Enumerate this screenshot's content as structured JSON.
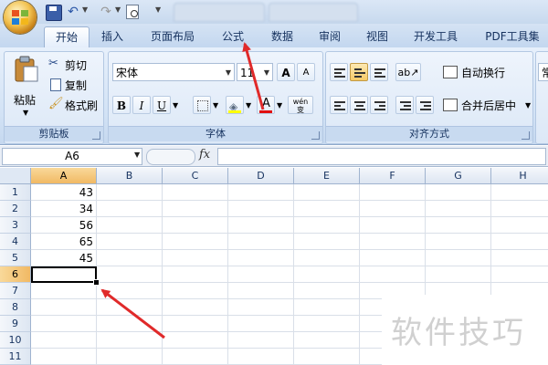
{
  "quick_access": {
    "icons": [
      "save-icon",
      "undo-icon",
      "redo-icon",
      "print-preview-icon"
    ]
  },
  "tabs": [
    {
      "label": "开始",
      "active": true
    },
    {
      "label": "插入"
    },
    {
      "label": "页面布局"
    },
    {
      "label": "公式"
    },
    {
      "label": "数据"
    },
    {
      "label": "审阅"
    },
    {
      "label": "视图"
    },
    {
      "label": "开发工具"
    },
    {
      "label": "PDF工具集"
    }
  ],
  "clipboard": {
    "paste": "粘贴",
    "cut": "剪切",
    "copy": "复制",
    "format_painter": "格式刷",
    "group_label": "剪贴板"
  },
  "font": {
    "name": "宋体",
    "size": "11",
    "bold": "B",
    "italic": "I",
    "underline": "U",
    "phonetic": "wén 变",
    "font_color": "A",
    "group_label": "字体",
    "grow": "A",
    "shrink": "A"
  },
  "alignment": {
    "wrap_text": "自动换行",
    "merge_center": "合并后居中",
    "group_label": "对齐方式"
  },
  "number_format_clip": "常",
  "formula_bar": {
    "name_box": "A6",
    "fx": "fx",
    "value": ""
  },
  "columns": [
    "A",
    "B",
    "C",
    "D",
    "E",
    "F",
    "G",
    "H"
  ],
  "rows": [
    "1",
    "2",
    "3",
    "4",
    "5",
    "6",
    "7",
    "8",
    "9",
    "10",
    "11"
  ],
  "cells": {
    "A1": "43",
    "A2": "34",
    "A3": "56",
    "A4": "65",
    "A5": "45"
  },
  "selected_cell": "A6",
  "watermark": "软件技巧",
  "colors": {
    "annotation_arrow": "#e02a2a",
    "selection_header": "#f4c57a",
    "ribbon": "#dce8f7"
  }
}
